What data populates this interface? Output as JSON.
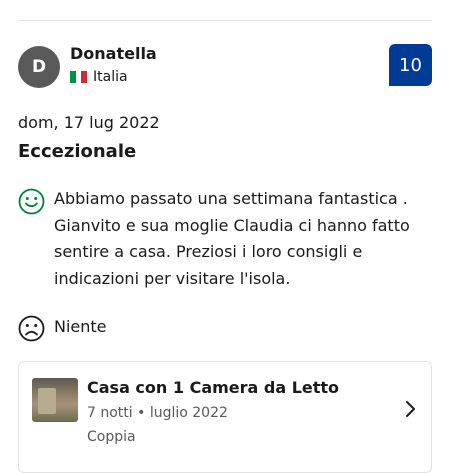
{
  "reviewer": {
    "initial": "D",
    "name": "Donatella",
    "country": "Italia",
    "score": "10"
  },
  "review": {
    "date": "dom, 17 lug 2022",
    "title": "Eccezionale",
    "positive_text": "Abbiamo passato una settimana fantastica . Gianvito e sua moglie Claudia ci hanno fatto sentire a casa. Preziosi i loro consigli e indicazioni per visitare l'isola.",
    "negative_text": "Niente"
  },
  "stay": {
    "room_name": "Casa con 1 Camera da Letto",
    "nights_date": "7 notti • luglio 2022",
    "traveler_type": "Coppia"
  },
  "colors": {
    "score_bg": "#003b95",
    "positive": "#008234",
    "negative": "#1a1a1a",
    "avatar_bg": "#595959"
  },
  "icons": {
    "positive": "smiley-face-icon",
    "negative": "sad-face-icon",
    "flag": "italy-flag-icon",
    "chevron": "chevron-right-icon"
  }
}
